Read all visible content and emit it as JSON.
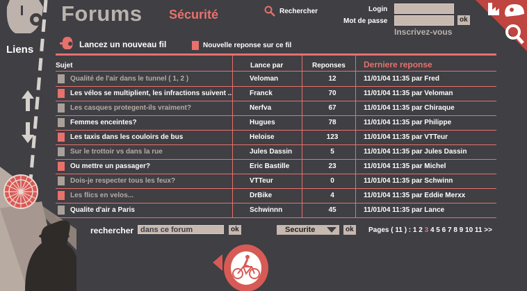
{
  "header": {
    "title": "Forums",
    "section": "Sécurité",
    "search_label": "Rechercher",
    "login_label": "Login",
    "password_label": "Mot de passe",
    "ok_label": "ok",
    "register_label": "Inscrivez-vous"
  },
  "sidebar": {
    "links_label": "Liens"
  },
  "actions": {
    "new_thread": "Lancez un nouveau fil",
    "new_reply": "Nouvelle reponse sur ce fil"
  },
  "table": {
    "headers": {
      "subject": "Sujet",
      "author": "Lance par",
      "replies": "Reponses",
      "last": "Derniere reponse"
    },
    "rows": [
      {
        "subject": "Qualité de l'air dans le tunnel ( 1, 2 )",
        "author": "Veloman",
        "replies": "12",
        "last": "11/01/04 11:35 par Fred",
        "marker": "grey",
        "dim": true
      },
      {
        "subject": "Les vélos se multiplient, les infractions suivent ..",
        "author": "Franck",
        "replies": "70",
        "last": "11/01/04 11:35 par Veloman",
        "marker": "red",
        "dim": false
      },
      {
        "subject": "Les casques protegent-ils vraiment?",
        "author": "Nerfva",
        "replies": "67",
        "last": "11/01/04 11:35 par Chiraque",
        "marker": "grey",
        "dim": true
      },
      {
        "subject": "Femmes enceintes?",
        "author": "Hugues",
        "replies": "78",
        "last": "11/01/04 11:35 par Philippe",
        "marker": "grey",
        "dim": false
      },
      {
        "subject": "Les taxis dans les couloirs de bus",
        "author": "Heloise",
        "replies": "123",
        "last": "11/01/04 11:35 par VTTeur",
        "marker": "red",
        "dim": false
      },
      {
        "subject": "Sur le trottoir vs dans la rue",
        "author": "Jules Dassin",
        "replies": "5",
        "last": "11/01/04 11:35 par Jules Dassin",
        "marker": "grey",
        "dim": true
      },
      {
        "subject": "Ou mettre un passager?",
        "author": "Eric Bastille",
        "replies": "23",
        "last": "11/01/04 11:35 par Michel",
        "marker": "red",
        "dim": false
      },
      {
        "subject": "Dois-je respecter tous les feux?",
        "author": "VTTeur",
        "replies": "0",
        "last": "11/01/04 11:35 par Schwinn",
        "marker": "grey",
        "dim": true
      },
      {
        "subject": "Les flics en velos...",
        "author": "DrBike",
        "replies": "4",
        "last": "11/01/04 11:35 par Eddie Merxx",
        "marker": "red",
        "dim": true
      },
      {
        "subject": "Qualite d'air a Paris",
        "author": "Schwinnn",
        "replies": "45",
        "last": "11/01/04 11:35 par Lance",
        "marker": "grey",
        "dim": false
      }
    ]
  },
  "bottom": {
    "search_label": "rechercher",
    "search_value": "dans ce forum",
    "ok_label": "ok",
    "forum_select": "Securite",
    "pages_prefix": "Pages ( 11 ) :",
    "pages": [
      "1",
      "2",
      "3",
      "4",
      "5",
      "6",
      "7",
      "8",
      "9",
      "10",
      "11",
      ">>"
    ],
    "current_page": "3"
  },
  "colors": {
    "background": "#3f3f44",
    "accent": "#e8716c",
    "beige": "#c7b9b0",
    "muted_text": "#b9b3ad",
    "dim_text": "#b5aca6"
  },
  "icons": [
    "bell-icon",
    "magnifier-icon",
    "factory-icon",
    "helmet-icon",
    "zoom-icon",
    "bicycle-icon",
    "wheel-icon",
    "arrow-up-icon",
    "arrow-down-icon",
    "play-left-icon"
  ]
}
